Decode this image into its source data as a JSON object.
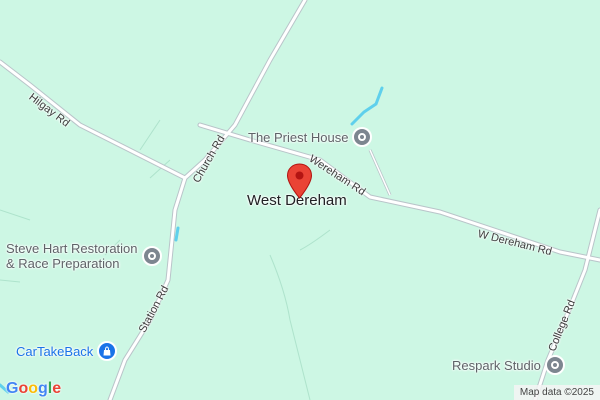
{
  "map": {
    "colors": {
      "land": "#cdf7e4",
      "road_fill": "#ffffff",
      "road_edge": "#b9c4c9",
      "water": "#5fd0ec",
      "pin": "#ea4335"
    },
    "place_name": "West Dereham",
    "roads": {
      "hilgay": "Hilgay Rd",
      "church": "Church Rd",
      "wereham": "Wereham Rd",
      "w_dereham": "W Dereham Rd",
      "station": "Station Rd",
      "college": "College Rd"
    },
    "pois": {
      "priest_house": {
        "label": "The Priest House",
        "icon": "museum-icon"
      },
      "steve_hart_line1": "Steve Hart Restoration",
      "steve_hart_line2": "& Race Preparation",
      "respark": {
        "label": "Respark Studio",
        "icon": "business-icon"
      },
      "cartakeback": {
        "label": "CarTakeBack",
        "icon": "shopping-bag-icon"
      }
    },
    "marker": {
      "icon": "location-pin-icon"
    },
    "logo": {
      "letters": [
        "G",
        "o",
        "o",
        "g",
        "l",
        "e"
      ],
      "colors": [
        "#4285F4",
        "#EA4335",
        "#FBBC05",
        "#4285F4",
        "#34A853",
        "#EA4335"
      ]
    },
    "attribution": "Map data ©2025"
  }
}
